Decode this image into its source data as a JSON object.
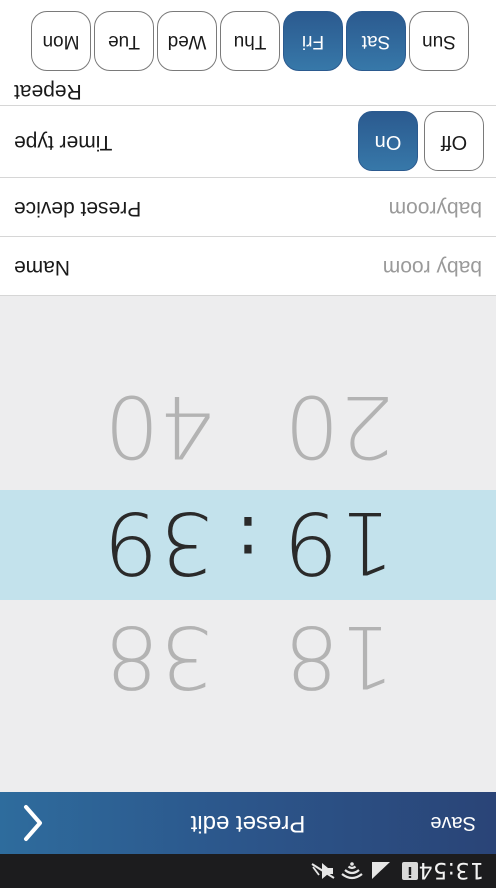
{
  "status_bar": {
    "time": "13:54",
    "icons": [
      "info-icon",
      "signal-icon",
      "wifi-icon",
      "mute-icon"
    ]
  },
  "title_bar": {
    "title": "Preset edit",
    "save_label": "Save",
    "back_icon": "chevron-left-icon"
  },
  "time_picker": {
    "hour_prev": "18",
    "hour_selected": "19",
    "hour_next": "20",
    "separator": ":",
    "minute_prev": "38",
    "minute_selected": "39",
    "minute_next": "40"
  },
  "settings": {
    "name": {
      "label": "Name",
      "value": "baby room"
    },
    "preset_device": {
      "label": "Preset device",
      "value": "babyroom"
    },
    "timer_type": {
      "label": "Timer type",
      "on_label": "On",
      "off_label": "Off",
      "selected": "On"
    },
    "repeat": {
      "label": "Repeat",
      "days": [
        {
          "label": "Mon",
          "active": false
        },
        {
          "label": "Tue",
          "active": false
        },
        {
          "label": "Wed",
          "active": false
        },
        {
          "label": "Thu",
          "active": false
        },
        {
          "label": "Fri",
          "active": true
        },
        {
          "label": "Sat",
          "active": true
        },
        {
          "label": "Sun",
          "active": false
        }
      ]
    }
  },
  "colors": {
    "accent": "#2b5a8f",
    "header_start": "#2a4477",
    "header_end": "#2e6c9d",
    "selection_band": "#c3e2ec",
    "background": "#ededee"
  }
}
